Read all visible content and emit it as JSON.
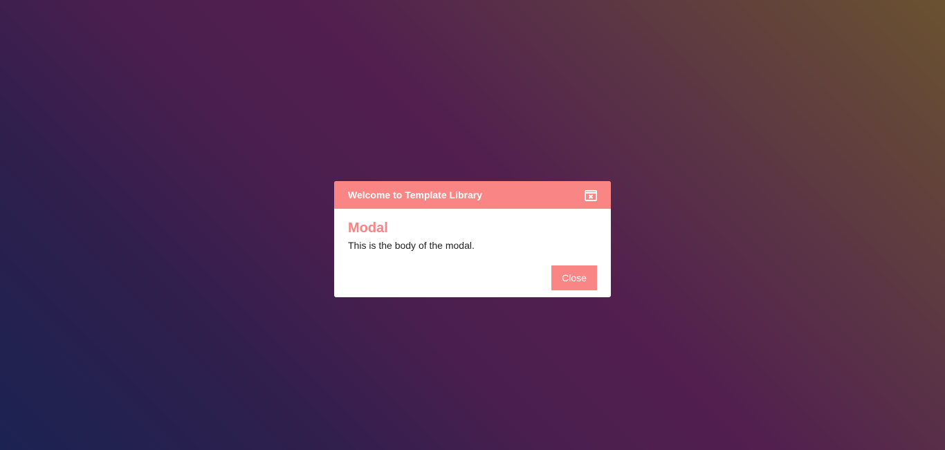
{
  "modal": {
    "title": "Welcome to Template Library",
    "heading": "Modal",
    "body_text": "This is the body of the modal.",
    "close_button_label": "Close",
    "close_icon": "close-icon"
  },
  "colors": {
    "accent": "#f98585",
    "modal_bg": "#ffffff",
    "text": "#222222",
    "background_start": "#1b2352",
    "background_mid": "#521f4f",
    "background_end": "#6a5230"
  }
}
